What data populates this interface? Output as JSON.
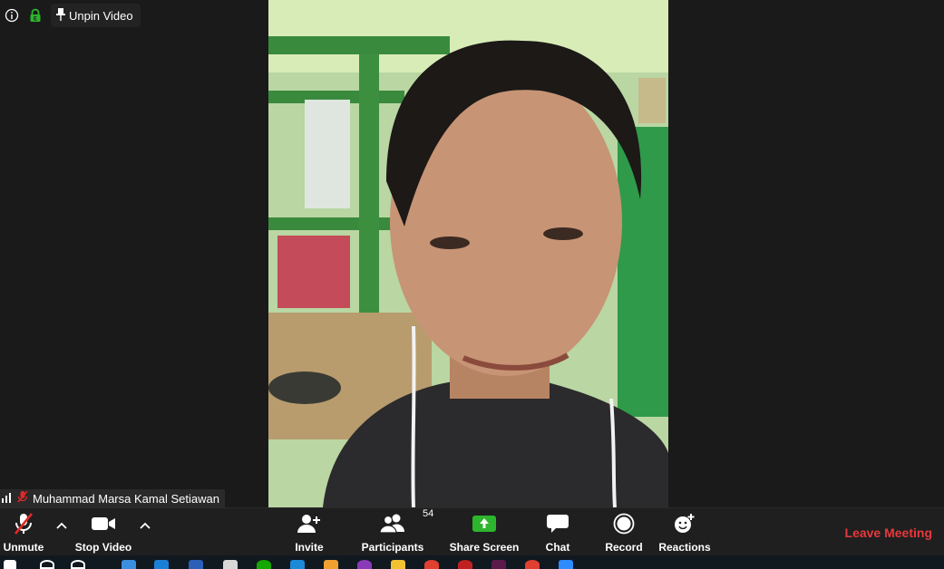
{
  "top_bar": {
    "info_icon": "info-icon",
    "lock_icon": "lock-icon",
    "unpin_label": "Unpin Video"
  },
  "participant": {
    "name": "Muhammad Marsa Kamal Setiawan",
    "signal_icon": "signal-bars-icon",
    "muted_icon": "mic-muted-icon"
  },
  "toolbar": {
    "unmute_label": "Unmute",
    "stop_video_label": "Stop Video",
    "invite_label": "Invite",
    "participants_label": "Participants",
    "participants_count": "54",
    "share_screen_label": "Share Screen",
    "chat_label": "Chat",
    "record_label": "Record",
    "reactions_label": "Reactions",
    "leave_label": "Leave Meeting"
  },
  "colors": {
    "toolbar_bg": "#1f1f1f",
    "stage_bg": "#1a1a1a",
    "share_green": "#2db52d",
    "leave_red": "#e8383d",
    "mute_slash_red": "#e02828"
  },
  "taskbar": {
    "apps": [
      "windows-start-icon",
      "search-icon",
      "cortana-icon",
      "task-view-icon",
      "edge-icon",
      "word-icon",
      "paint-icon",
      "upwork-icon",
      "vscode-icon",
      "app-icon",
      "onenote-icon",
      "file-explorer-icon",
      "chrome-icon",
      "media-icon",
      "xd-icon",
      "chrome-icon-2",
      "zoom-icon"
    ]
  }
}
